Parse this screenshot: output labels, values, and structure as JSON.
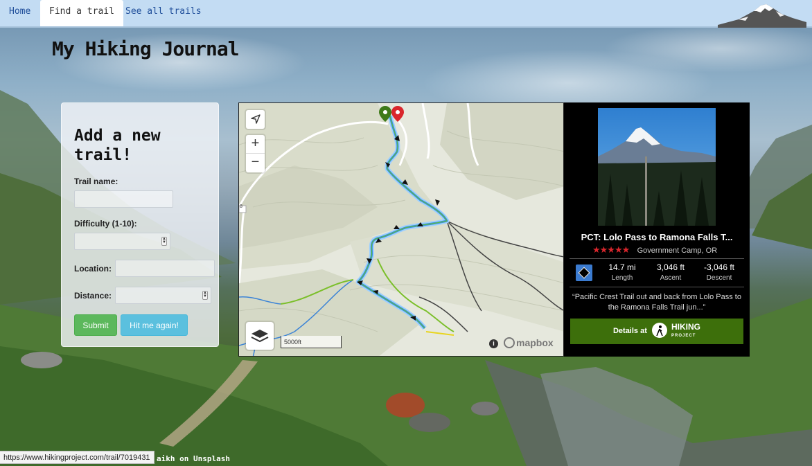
{
  "nav": {
    "home": "Home",
    "find": "Find a trail",
    "all": "See all trails"
  },
  "page": {
    "title": "My Hiking Journal",
    "credit": "aikh on Unsplash",
    "status_url": "https://www.hikingproject.com/trail/7019431"
  },
  "form": {
    "heading": "Add a new trail!",
    "trail_name_label": "Trail name:",
    "difficulty_label": "Difficulty (1-10):",
    "location_label": "Location:",
    "distance_label": "Distance:",
    "submit_label": "Submit",
    "hit_label": "Hit me again!"
  },
  "map": {
    "scale_label": "5000ft",
    "info_label": "i",
    "logo_label": "mapbox",
    "road_marker": "8"
  },
  "trail": {
    "name": "PCT: Lolo Pass to Ramona Falls T...",
    "location": "Government Camp, OR",
    "rating_stars": 4.5,
    "length_value": "14.7 mi",
    "length_label": "Length",
    "ascent_value": "3,046 ft",
    "ascent_label": "Ascent",
    "descent_value": "-3,046 ft",
    "descent_label": "Descent",
    "summary": "“Pacific Crest Trail out and back from Lolo Pass to the Ramona Falls Trail jun...”",
    "details_label": "Details at",
    "brand_top": "HIKING",
    "brand_bottom": "PROJECT"
  },
  "colors": {
    "nav_bg": "#c3dcf3",
    "submit": "#5cb85c",
    "hit": "#5bc0de",
    "details_bg": "#3d6f0b",
    "stars": "#d9262c"
  }
}
